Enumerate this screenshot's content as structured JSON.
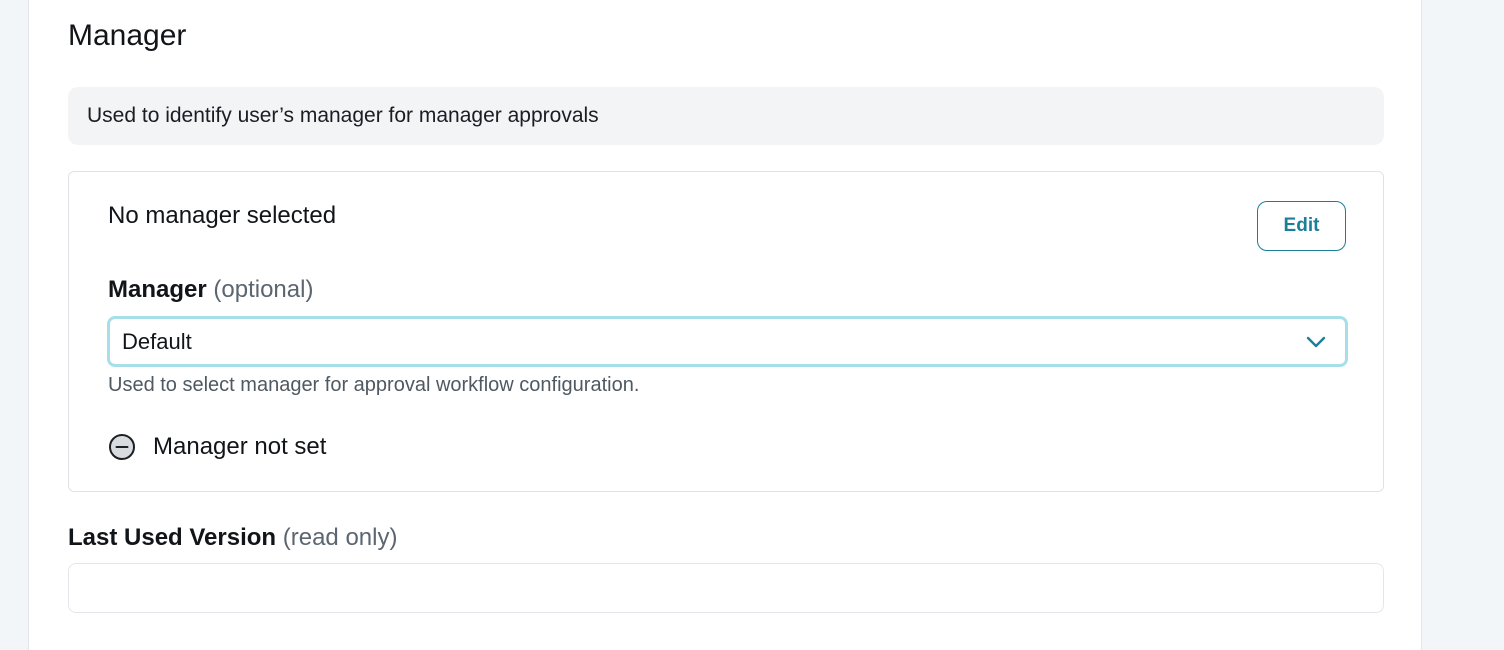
{
  "section": {
    "title": "Manager",
    "info": "Used to identify user’s manager for manager approvals"
  },
  "card": {
    "heading": "No manager selected",
    "edit_label": "Edit",
    "field_label": "Manager",
    "field_label_suffix": "(optional)",
    "select_value": "Default",
    "select_icon": "chevron-down-icon",
    "helper": "Used to select manager for approval workflow configuration.",
    "status_icon": "minus-circle-icon",
    "status_text": "Manager not set"
  },
  "last_used_version": {
    "label": "Last Used Version",
    "label_suffix": "(read only)",
    "value": ""
  },
  "colors": {
    "accent": "#1b7f99",
    "focus_ring": "#a6dfe9",
    "info_bg": "#f2f4f6",
    "page_bg": "#f3f6f8"
  }
}
